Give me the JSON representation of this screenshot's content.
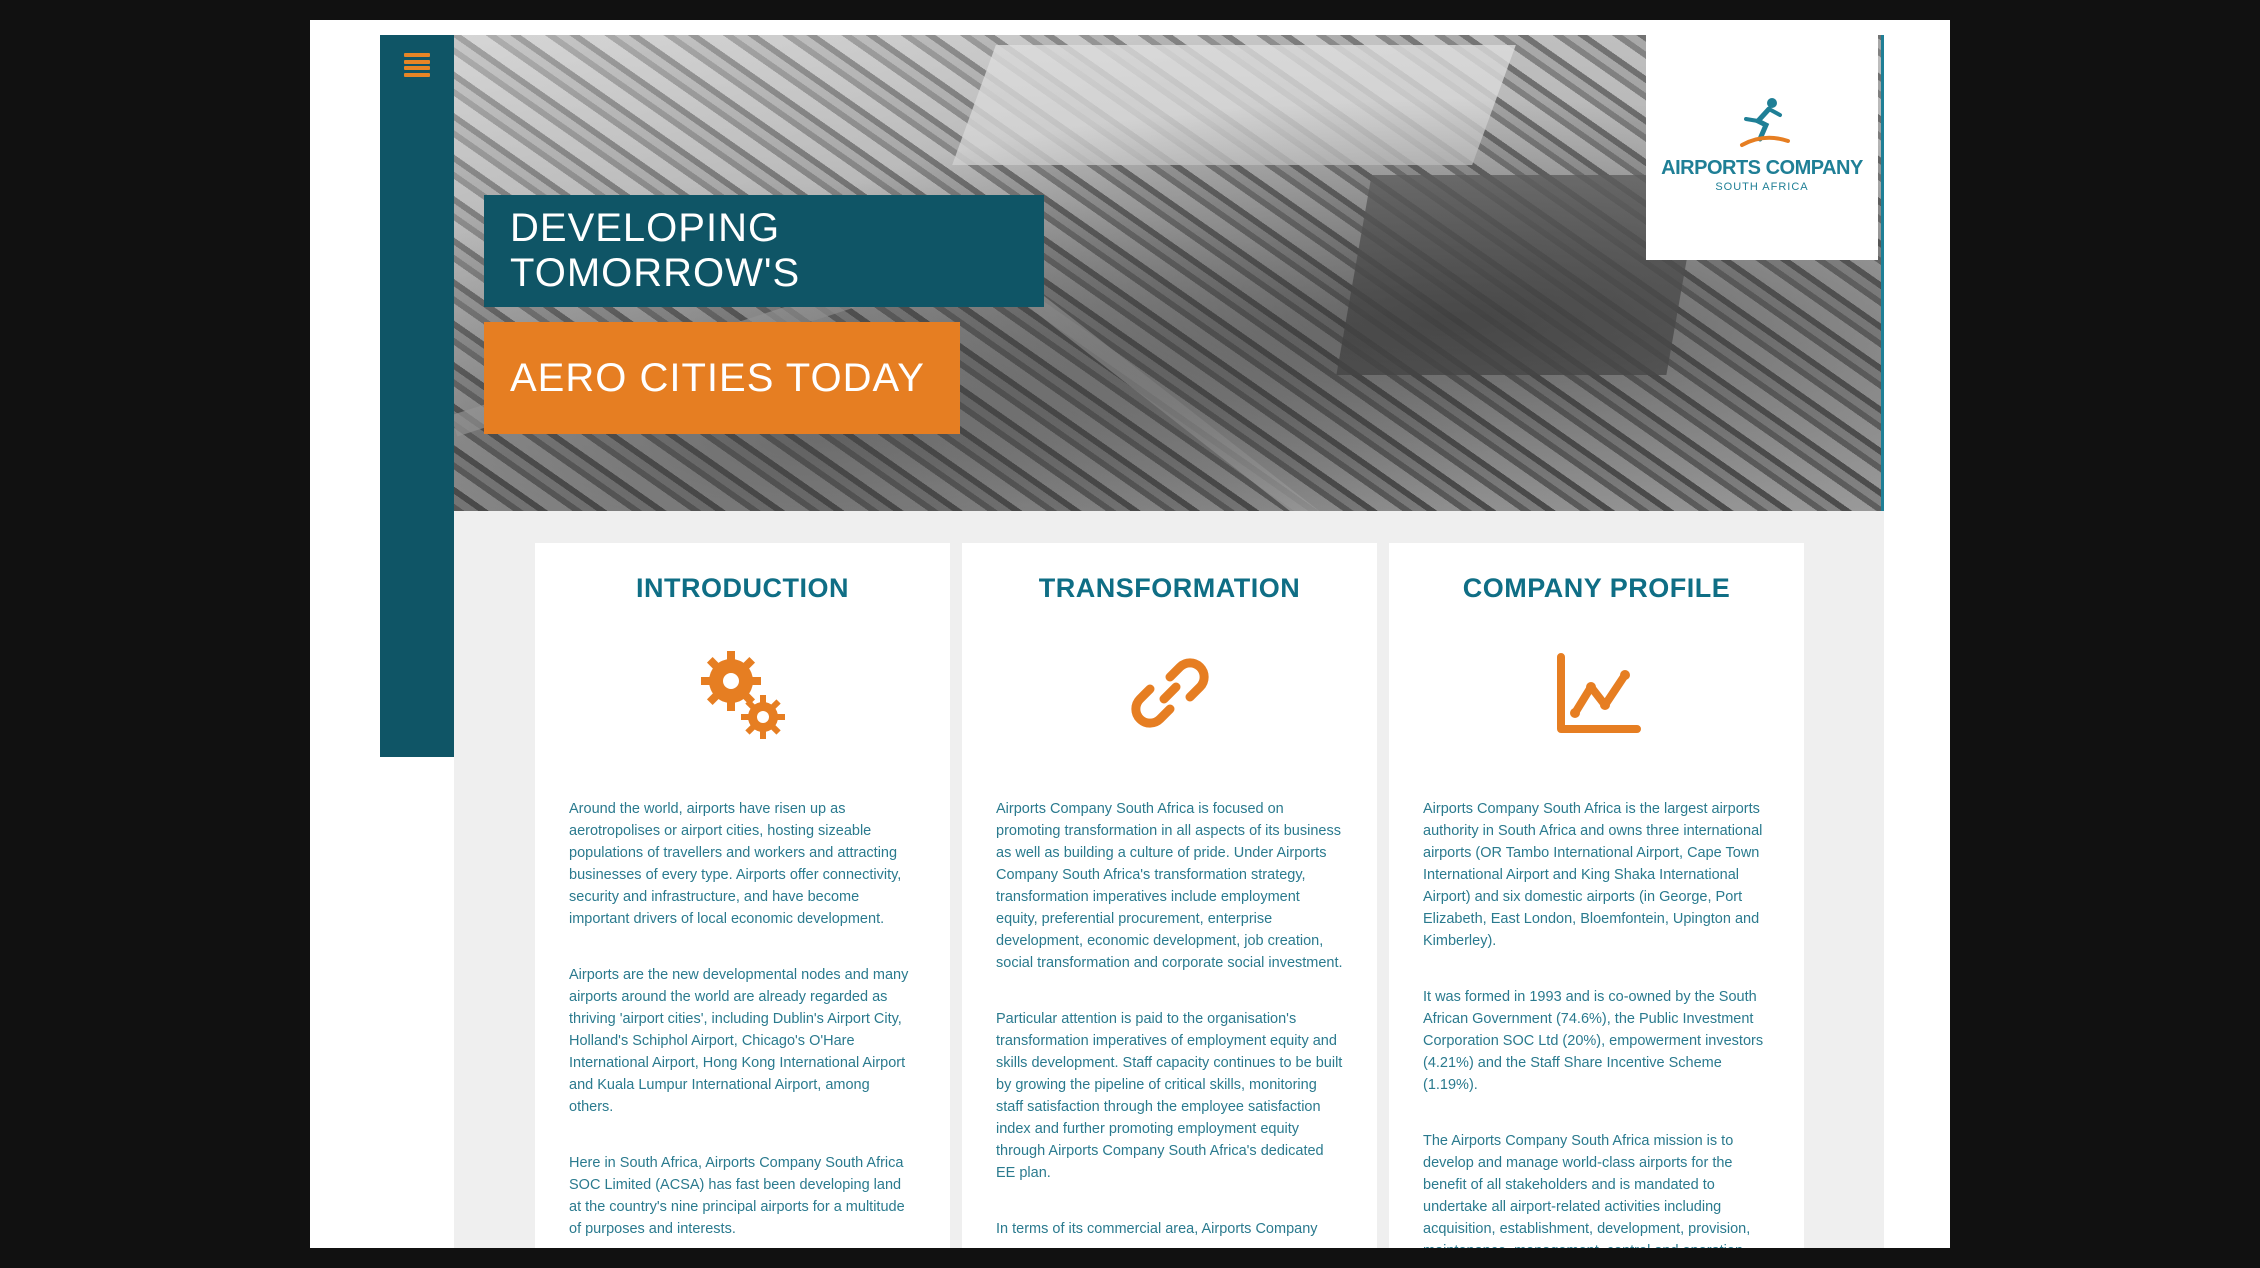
{
  "menu": {
    "icon": "hamburger-menu-icon"
  },
  "hero": {
    "line1": "DEVELOPING TOMORROW'S",
    "line2": "AERO CITIES TODAY",
    "logo_name": "AIRPORTS COMPANY",
    "logo_sub": "SOUTH AFRICA"
  },
  "colors": {
    "teal": "#0f5566",
    "orange": "#e67e22",
    "text_teal": "#0f6e85"
  },
  "cards": [
    {
      "title": "INTRODUCTION",
      "icon": "gears-icon",
      "paragraphs": [
        "Around the world, airports have risen up as aerotropolises or airport cities, hosting sizeable populations of travellers and workers and attracting businesses of every type. Airports offer connectivity, security and infrastructure, and have become important drivers of local economic development.",
        "Airports are the new developmental nodes and many airports around the world are already regarded as thriving 'airport cities', including Dublin's Airport City, Holland's Schiphol Airport, Chicago's O'Hare International Airport, Hong Kong International Airport and Kuala Lumpur International Airport, among others.",
        "Here in South Africa, Airports Company South Africa SOC Limited (ACSA) has fast been developing land at the country's nine principal airports for a multitude of purposes and interests."
      ]
    },
    {
      "title": "TRANSFORMATION",
      "icon": "link-icon",
      "paragraphs": [
        "Airports Company South Africa is focused on promoting transformation in all aspects of its business as well as building a culture of pride. Under Airports Company South Africa's transformation strategy, transformation imperatives include employment equity, preferential procurement, enterprise development, economic development, job creation, social transformation and corporate social investment.",
        "Particular attention is paid to the organisation's transformation imperatives of employment equity and skills development. Staff capacity continues to be built by growing the pipeline of critical skills, monitoring staff satisfaction through the employee satisfaction index and further promoting employment equity through Airports Company South Africa's dedicated EE plan.",
        "In terms of its commercial area, Airports Company"
      ]
    },
    {
      "title": "COMPANY PROFILE",
      "icon": "line-chart-icon",
      "paragraphs": [
        "Airports Company South Africa is the largest airports authority in South Africa and owns three international airports (OR Tambo International Airport, Cape Town International Airport and King Shaka International Airport) and six domestic airports (in George, Port Elizabeth, East London, Bloemfontein, Upington and Kimberley).",
        "It was formed in 1993 and is co-owned by the South African Government (74.6%), the Public Investment Corporation SOC Ltd (20%), empowerment investors (4.21%) and the Staff Share Incentive Scheme (1.19%).",
        "The Airports Company South Africa mission is to develop and manage world-class airports for the benefit of all stakeholders and is mandated to undertake all airport-related activities including acquisition, establishment, development, provision, maintenance, management, control and operation."
      ]
    }
  ]
}
